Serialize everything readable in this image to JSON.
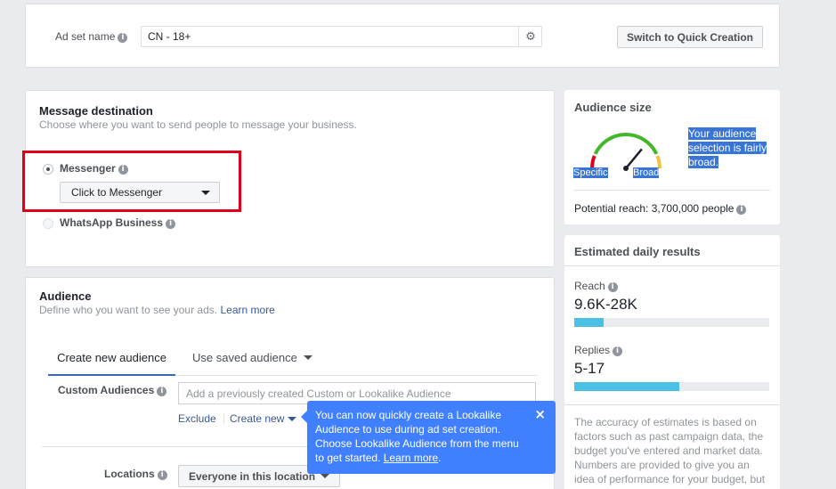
{
  "adset": {
    "name_label": "Ad set name",
    "name_value": "CN - 18+",
    "quick_creation_button": "Switch to Quick Creation"
  },
  "message_destination": {
    "title": "Message destination",
    "subtitle": "Choose where you want to send people to message your business.",
    "options": [
      {
        "label": "Messenger",
        "selected": true
      },
      {
        "label": "WhatsApp Business",
        "selected": false
      }
    ],
    "messenger_dropdown_value": "Click to Messenger"
  },
  "audience": {
    "title": "Audience",
    "subtitle": "Define who you want to see your ads.",
    "learn_more": "Learn more",
    "tabs": [
      {
        "label": "Create new audience",
        "active": true
      },
      {
        "label": "Use saved audience",
        "active": false
      }
    ],
    "custom_audiences_label": "Custom Audiences",
    "custom_audiences_placeholder": "Add a previously created Custom or Lookalike Audience",
    "exclude_link": "Exclude",
    "create_new_link": "Create new",
    "tooltip": {
      "text": "You can now quickly create a Lookalike Audience to use during ad set creation. Choose Lookalike Audience from the menu to get started.",
      "learn_more": "Learn more",
      "close": "×"
    },
    "locations_label": "Locations",
    "locations_value": "Everyone in this location"
  },
  "audience_size": {
    "title": "Audience size",
    "gauge_left_label": "Specific",
    "gauge_right_label": "Broad",
    "gauge_level": 0.72,
    "description": "Your audience selection is fairly broad.",
    "potential_reach": "Potential reach: 3,700,000 people"
  },
  "estimated_daily_results": {
    "title": "Estimated daily results",
    "metrics": [
      {
        "label": "Reach",
        "value": "9.6K-28K",
        "fill_fraction": 0.15
      },
      {
        "label": "Replies",
        "value": "5-17",
        "fill_fraction": 0.54
      }
    ],
    "disclaimer": "The accuracy of estimates is based on factors such as past campaign data, the budget you've entered and market data. Numbers are provided to give you an idea of performance for your budget, but"
  },
  "colors": {
    "highlight_red": "#e0001b",
    "tooltip_blue": "#4080ff",
    "bar_blue": "#4ac1e4",
    "selection_blue": "#3875d7"
  }
}
